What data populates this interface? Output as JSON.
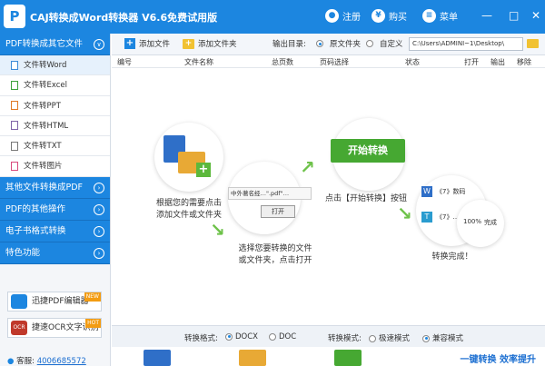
{
  "app": {
    "title": "CAJ转换成Word转换器 V6.6免费试用版",
    "logo_letter": "P",
    "register_label": "注册",
    "buy_label": "购买",
    "menu_label": "菜单"
  },
  "sidebar": {
    "section_main": "PDF转换成其它文件",
    "items": [
      {
        "label": "文件转Word"
      },
      {
        "label": "文件转Excel"
      },
      {
        "label": "文件转PPT"
      },
      {
        "label": "文件转HTML"
      },
      {
        "label": "文件转TXT"
      },
      {
        "label": "文件转图片"
      }
    ],
    "sections": [
      {
        "label": "其他文件转换成PDF"
      },
      {
        "label": "PDF的其他操作"
      },
      {
        "label": "电子书格式转换"
      },
      {
        "label": "特色功能"
      }
    ],
    "promos": [
      {
        "label": "迅捷PDF编辑器",
        "tag": "NEW"
      },
      {
        "label": "捷速OCR文字识别",
        "tag": "HOT",
        "icon_text": "OCR"
      }
    ],
    "support_label": "客服:",
    "support_qq": "4006685572"
  },
  "toolbar": {
    "add_file": "添加文件",
    "add_folder": "添加文件夹",
    "output_label": "输出目录:",
    "opt_original": "原文件夹",
    "opt_custom": "自定义",
    "output_path": "C:\\Users\\ADMINI~1\\Desktop\\"
  },
  "columns": [
    "编号",
    "文件名称",
    "总页数",
    "页码选择",
    "状态",
    "打开",
    "输出",
    "移除"
  ],
  "guide": {
    "step1": "根据您的需要点击\n添加文件或文件夹",
    "step2": "选择您要转换的文件\n或文件夹，点击打开",
    "step3": "点击【开始转换】按钮",
    "step4": "转换完成！",
    "start_button": "开始转换",
    "dialog_filename": "中外著名经…\".pdf\"…",
    "dialog_open": "打开",
    "result_item1": "《7》数码",
    "result_item2": "《7》…",
    "result_progress": "100%",
    "result_done": "完成"
  },
  "bottom": {
    "format_label": "转换格式:",
    "fmt_docx": "DOCX",
    "fmt_doc": "DOC",
    "mode_label": "转换模式:",
    "mode_fast": "极速模式",
    "mode_compat": "兼容模式",
    "slogan": "一键转换 效率提升"
  }
}
